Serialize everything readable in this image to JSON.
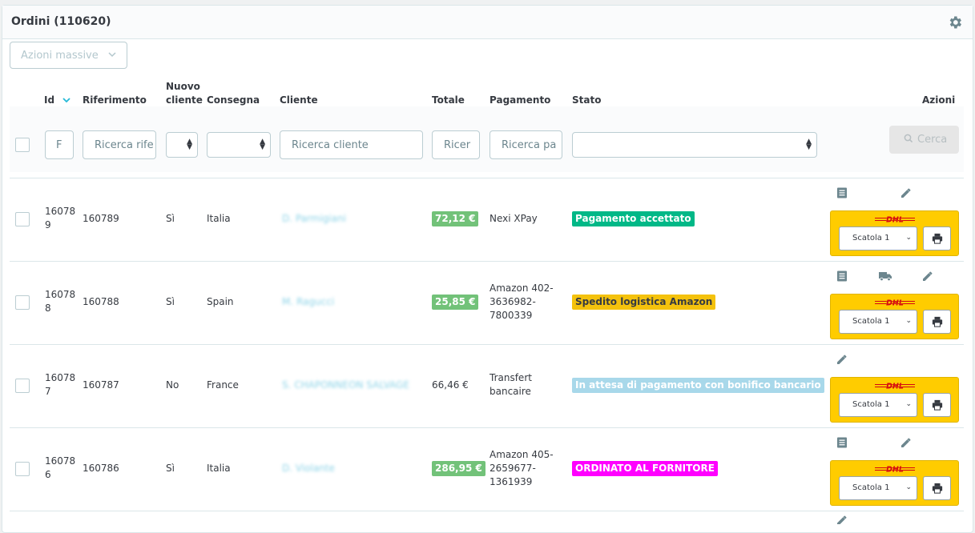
{
  "panel": {
    "title": "Ordini (110620)"
  },
  "bulk_actions": {
    "label": "Azioni massive"
  },
  "columns": {
    "id": "Id",
    "reference": "Riferimento",
    "new_customer_line1": "Nuovo",
    "new_customer_line2": "cliente",
    "delivery": "Consegna",
    "customer": "Cliente",
    "total": "Totale",
    "payment": "Pagamento",
    "status": "Stato",
    "actions": "Azioni"
  },
  "filters": {
    "id_placeholder": "F",
    "reference_placeholder": "Ricerca rife",
    "customer_placeholder": "Ricerca cliente",
    "total_placeholder": "Ricer",
    "payment_placeholder": "Ricerca pa",
    "search_button": "Cerca"
  },
  "rows": [
    {
      "id_l1": "16078",
      "id_l2": "9",
      "reference": "160789",
      "new_customer": "Sì",
      "delivery": "Italia",
      "customer": "D. Parmigiani",
      "total": "72,12 €",
      "total_highlight": true,
      "payment": [
        "Nexi XPay"
      ],
      "status": "Pagamento accettato",
      "status_bg": "#01b887",
      "status_color": "#ffffff",
      "actions": [
        "invoice",
        "edit"
      ],
      "dhl_box": "Scatola 1"
    },
    {
      "id_l1": "16078",
      "id_l2": "8",
      "reference": "160788",
      "new_customer": "Sì",
      "delivery": "Spain",
      "customer": "M. Ragucci",
      "total": "25,85 €",
      "total_highlight": true,
      "payment": [
        "Amazon 402-",
        "3636982-",
        "7800339"
      ],
      "status": "Spedito logistica Amazon",
      "status_bg": "#f4c20d",
      "status_color": "#363a41",
      "actions": [
        "invoice",
        "truck",
        "edit"
      ],
      "dhl_box": "Scatola 1"
    },
    {
      "id_l1": "16078",
      "id_l2": "7",
      "reference": "160787",
      "new_customer": "No",
      "delivery": "France",
      "customer": "S. CHAPONNEON SALVAGE",
      "total": "66,46 €",
      "total_highlight": false,
      "payment": [
        "Transfert",
        "bancaire"
      ],
      "status": "In attesa di pagamento con bonifico bancario",
      "status_bg": "#a8d8ea",
      "status_color": "#ffffff",
      "actions": [
        "edit"
      ],
      "dhl_box": "Scatola 1"
    },
    {
      "id_l1": "16078",
      "id_l2": "6",
      "reference": "160786",
      "new_customer": "Sì",
      "delivery": "Italia",
      "customer": "D. Violante",
      "total": "286,95 €",
      "total_highlight": true,
      "payment": [
        "Amazon 405-",
        "2659677-",
        "1361939"
      ],
      "status": "ORDINATO AL FORNITORE",
      "status_bg": "#ff00ff",
      "status_color": "#ffffff",
      "actions": [
        "invoice",
        "edit"
      ],
      "dhl_box": "Scatola 1"
    }
  ]
}
